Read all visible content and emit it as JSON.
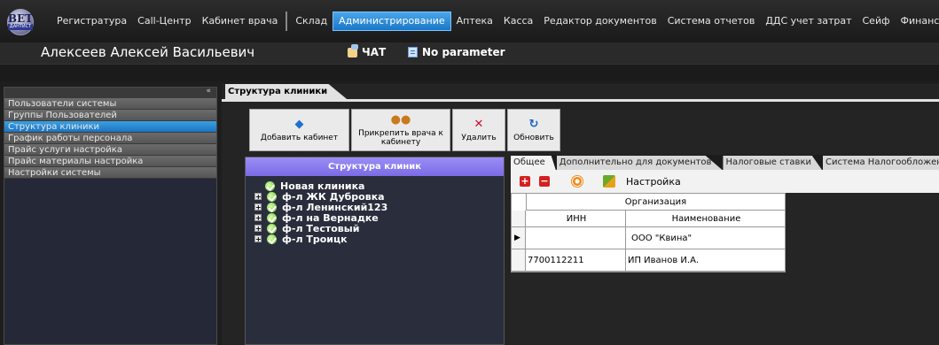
{
  "logo": {
    "line1": "BET",
    "line2": "ДАНТИСТ"
  },
  "menu": {
    "items": [
      {
        "label": "Регистратура",
        "active": false
      },
      {
        "label": "Call-Центр",
        "active": false
      },
      {
        "label": "Кабинет врача",
        "active": false
      },
      {
        "label": "Склад",
        "active": false
      },
      {
        "label": "Администрирование",
        "active": true
      },
      {
        "label": "Аптека",
        "active": false
      },
      {
        "label": "Касса",
        "active": false
      },
      {
        "label": "Редактор документов",
        "active": false
      },
      {
        "label": "Система отчетов",
        "active": false
      },
      {
        "label": "ДДС учет затрат",
        "active": false
      },
      {
        "label": "Сейф",
        "active": false
      },
      {
        "label": "Финансы",
        "active": false
      }
    ]
  },
  "user": {
    "name": "Алексеев Алексей Васильевич"
  },
  "chat": {
    "label": "ЧАТ"
  },
  "parameter": {
    "label": "No parameter"
  },
  "sidebar": {
    "collapse": "«",
    "items": [
      {
        "label": "Пользователи системы",
        "selected": false
      },
      {
        "label": "Группы Пользователей",
        "selected": false
      },
      {
        "label": "Структура клиники",
        "selected": true
      },
      {
        "label": "График работы персонала",
        "selected": false
      },
      {
        "label": "Прайс услуги настройка",
        "selected": false
      },
      {
        "label": "Прайс материалы настройка",
        "selected": false
      },
      {
        "label": "Настройки системы",
        "selected": false
      }
    ]
  },
  "main": {
    "tab_label": "Структура клиники"
  },
  "toolbar": {
    "add_cabinet": "Добавить кабинет",
    "attach_doctor": "Прикрепить врача к кабинету",
    "delete": "Удалить",
    "refresh": "Обновить"
  },
  "tree": {
    "title": "Структура клиник",
    "root": "Новая клиника",
    "children": [
      "ф-л ЖК Дубровка",
      "ф-л Ленинский123",
      "ф-л на Вернадке",
      "ф-л Тестовый",
      "ф-л Троицк"
    ]
  },
  "details": {
    "tabs": [
      {
        "label": "Общее",
        "active": true
      },
      {
        "label": "Дополнительно для документов",
        "active": false
      },
      {
        "label": "Налоговые ставки",
        "active": false
      },
      {
        "label": "Система Налогообложения",
        "active": false
      }
    ],
    "settings_label": "Настройка",
    "grid": {
      "band": "Организация",
      "col_inn": "ИНН",
      "col_name": "Наименование",
      "rows": [
        {
          "inn": "",
          "name": "ООО \"Квина\"",
          "current": true
        },
        {
          "inn": "7700112211",
          "name": "ИП Иванов И.А.",
          "current": false
        }
      ]
    }
  }
}
